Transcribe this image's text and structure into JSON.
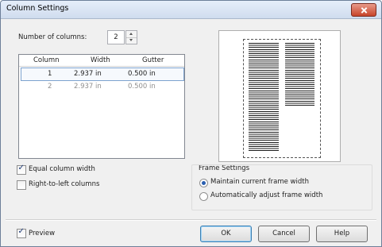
{
  "window": {
    "title": "Column Settings"
  },
  "columns": {
    "label": "Number of columns:",
    "value": "2"
  },
  "table": {
    "headers": [
      "Column",
      "Width",
      "Gutter"
    ],
    "rows": [
      {
        "column": "1",
        "width": "2.937 in",
        "gutter": "0.500 in"
      },
      {
        "column": "2",
        "width": "2.937 in",
        "gutter": "0.500 in"
      }
    ]
  },
  "options": {
    "equal_width": {
      "label": "Equal column width",
      "checked": true
    },
    "rtl": {
      "label": "Right-to-left columns",
      "checked": false
    }
  },
  "frame_settings": {
    "title": "Frame Settings",
    "maintain": {
      "label": "Maintain current frame width",
      "selected": true
    },
    "adjust": {
      "label": "Automatically adjust frame width",
      "selected": false
    }
  },
  "preview": {
    "label": "Preview",
    "checked": true
  },
  "buttons": {
    "ok": "OK",
    "cancel": "Cancel",
    "help": "Help"
  },
  "colors": {
    "title_bar": "#d6e2f2",
    "close_button": "#c7442a",
    "accent": "#3c7fb1"
  }
}
